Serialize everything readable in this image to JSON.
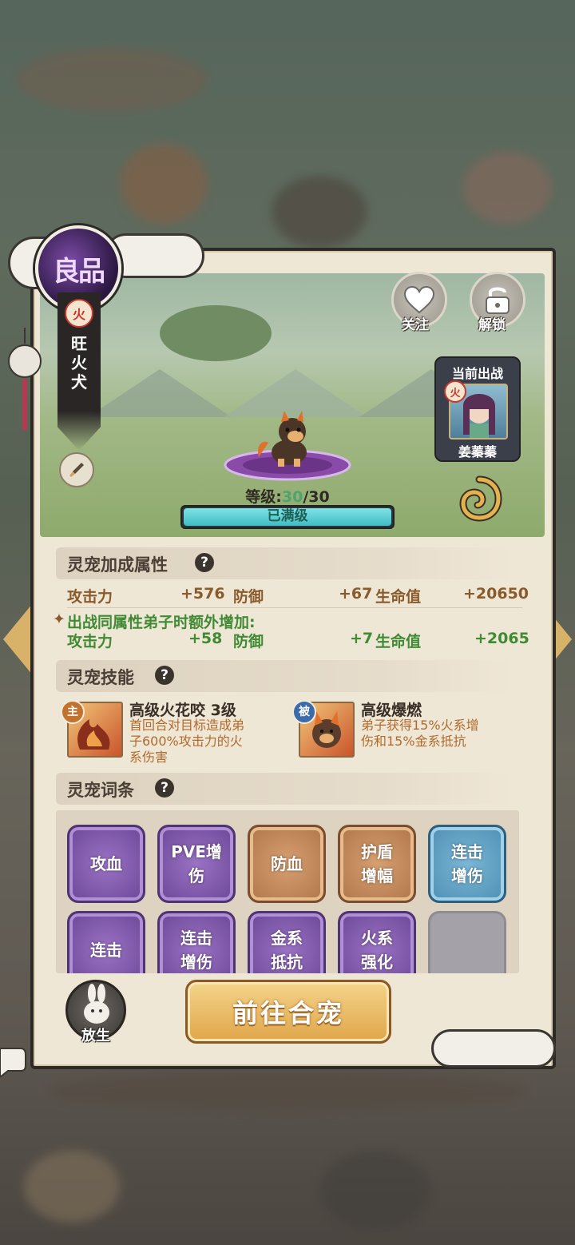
{
  "quality": "良品",
  "pet": {
    "element": "火",
    "name": "旺火犬"
  },
  "actions": {
    "follow": "关注",
    "unlock": "解锁"
  },
  "deployed": {
    "title": "当前出战",
    "element": "火",
    "name": "姜蓁蓁"
  },
  "level": {
    "label": "等级:",
    "current": "30",
    "sep": "/",
    "max": "30",
    "status": "已满级",
    "fraction": 1.0
  },
  "bonus": {
    "title": "灵宠加成属性",
    "base": {
      "atk_label": "攻击力",
      "atk": "+576",
      "def_label": "防御",
      "def": "+67",
      "hp_label": "生命值",
      "hp": "+20650"
    },
    "extra_title": "出战同属性弟子时额外增加:",
    "extra": {
      "atk_label": "攻击力",
      "atk": "+58",
      "def_label": "防御",
      "def": "+7",
      "hp_label": "生命值",
      "hp": "+2065"
    }
  },
  "skills": {
    "title": "灵宠技能",
    "active": {
      "tag": "主",
      "name": "高级火花咬 3级",
      "desc": [
        "首回合对目标造成弟",
        "子600%攻击力的火",
        "系伤害"
      ]
    },
    "passive": {
      "tag": "被",
      "name": "高级爆燃",
      "desc": [
        "弟子获得15%火系增",
        "伤和15%金系抵抗"
      ]
    }
  },
  "traits": {
    "title": "灵宠词条",
    "items": [
      {
        "l1": "攻血",
        "l2": "",
        "color": "purple"
      },
      {
        "l1": "PVE增",
        "l2": "伤",
        "color": "purple"
      },
      {
        "l1": "防血",
        "l2": "",
        "color": "orange"
      },
      {
        "l1": "护盾",
        "l2": "增幅",
        "color": "orange"
      },
      {
        "l1": "连击",
        "l2": "增伤",
        "color": "blue"
      },
      {
        "l1": "连击",
        "l2": "",
        "color": "purple"
      },
      {
        "l1": "连击",
        "l2": "增伤",
        "color": "purple"
      },
      {
        "l1": "金系",
        "l2": "抵抗",
        "color": "purple"
      },
      {
        "l1": "火系",
        "l2": "强化",
        "color": "purple"
      }
    ]
  },
  "buttons": {
    "release": "放生",
    "go_merge": "前往合宠"
  },
  "colors": {
    "accent_gold": "#e0a64a",
    "green": "#3f8a33",
    "purple": "#6d4897"
  }
}
